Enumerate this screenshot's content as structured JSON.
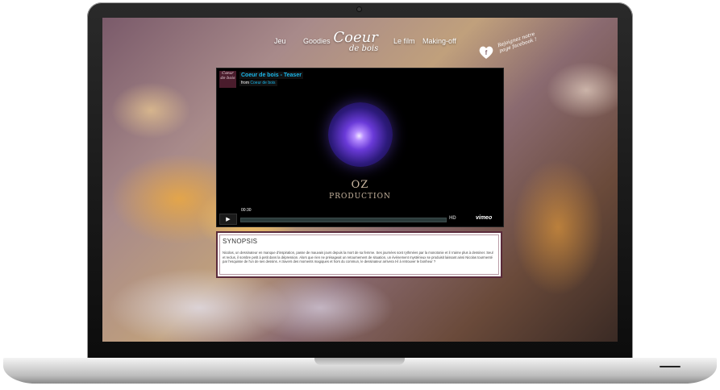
{
  "nav": {
    "items": [
      "Jeu",
      "Goodies",
      "Le film",
      "Making-off"
    ],
    "logo_line1": "Coeur",
    "logo_line2": "de bois",
    "facebook_text": "Rejoignez notre page facebook !"
  },
  "video": {
    "title": "Coeur de bois - Teaser",
    "from_label": "from",
    "from_link": "Coeur de bois",
    "thumb_text": "Cœur de bois",
    "overlay_line1": "OZ",
    "overlay_line2": "PRODUCTION",
    "time": "00:30",
    "hd_label": "HD",
    "vimeo_label": "vimeo"
  },
  "synopsis": {
    "title": "SYNOPSIS",
    "text": "Nicolas, un dessinateur en manque d'inspiration, passe de mauvais jours depuis la mort de sa femme. Ses journées sont rythmées par la monotonie et il n'aime plus à dessiner. Seul et reclus, il sombre petit à petit dans la dépression. Alors que rien ne présageait un retournement de situation, un événement mystérieux se produisit laissant ainsi Nicolas tourmenté par l'esquisse de l'un de ses dessins. A travers des moments magiques et hors du commun, le dessinateur arrivera t-il à retrouver le bonheur ?"
  },
  "colors": {
    "vimeo_blue": "#1ab7ea",
    "synopsis_border": "#5a2a3a"
  }
}
